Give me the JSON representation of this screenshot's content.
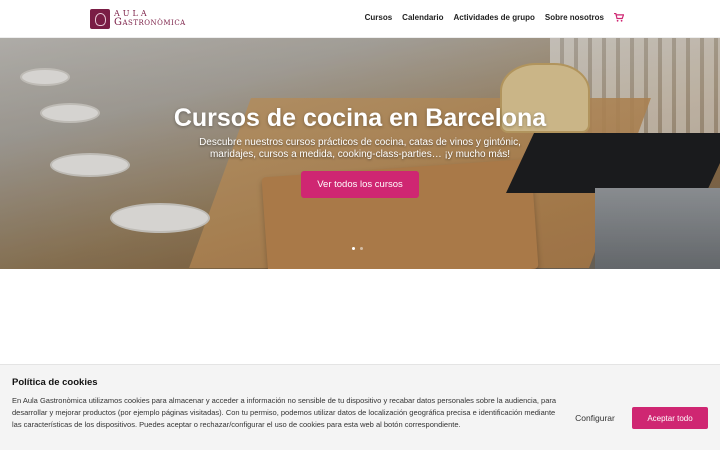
{
  "header": {
    "logo_line1": "AULA",
    "logo_line2": "Gastronòmica",
    "nav": [
      "Cursos",
      "Calendario",
      "Actividades de grupo",
      "Sobre nosotros"
    ],
    "cart_icon": "shopping-cart-icon"
  },
  "hero": {
    "title": "Cursos de cocina en Barcelona",
    "subtitle": "Descubre nuestros cursos prácticos de cocina, catas de vinos y gintónic, maridajes, cursos a medida, cooking-class-parties… ¡y mucho más!",
    "cta": "Ver todos los cursos",
    "slides": 2,
    "active_slide": 1
  },
  "cookie": {
    "title": "Política de cookies",
    "text": "En Aula Gastronòmica utilizamos cookies para almacenar y acceder a información no sensible de tu dispositivo y recabar datos personales sobre la audiencia, para desarrollar y mejorar productos (por ejemplo páginas visitadas). Con tu permiso, podemos utilizar datos de localización geográfica precisa e identificación mediante las características de los dispositivos. Puedes aceptar o rechazar/configurar el uso de cookies para esta web al botón correspondiente.",
    "configure": "Configurar",
    "accept": "Aceptar todo"
  },
  "colors": {
    "brand": "#7a1d45",
    "accent": "#cf2672"
  }
}
